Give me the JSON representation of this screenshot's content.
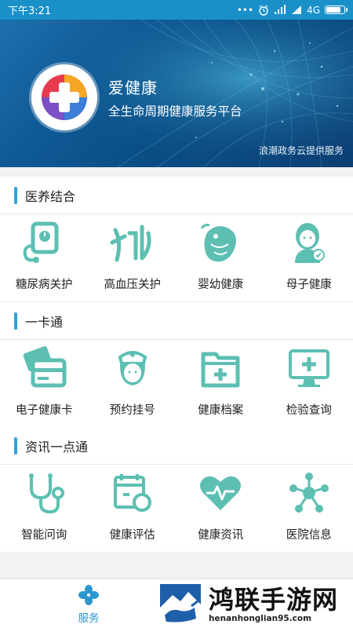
{
  "status_bar": {
    "time": "下午3:21",
    "network": "4G",
    "battery_level": 0.85
  },
  "banner": {
    "app_name": "爱健康",
    "subtitle": "全生命周期健康服务平台",
    "provider": "浪潮政务云提供服务"
  },
  "sections": [
    {
      "title": "医养结合",
      "items": [
        {
          "label": "糖尿病关护",
          "icon": "glucose-meter-icon"
        },
        {
          "label": "高血压关护",
          "icon": "blood-pressure-icon"
        },
        {
          "label": "婴幼健康",
          "icon": "baby-fish-icon"
        },
        {
          "label": "母子健康",
          "icon": "mother-child-icon"
        }
      ]
    },
    {
      "title": "一卡通",
      "items": [
        {
          "label": "电子健康卡",
          "icon": "health-card-icon"
        },
        {
          "label": "预约挂号",
          "icon": "nurse-icon"
        },
        {
          "label": "健康档案",
          "icon": "medical-folder-icon"
        },
        {
          "label": "检验查询",
          "icon": "monitor-cross-icon"
        }
      ]
    },
    {
      "title": "资讯一点通",
      "items": [
        {
          "label": "智能问询",
          "icon": "stethoscope-icon"
        },
        {
          "label": "健康评估",
          "icon": "calendar-check-icon"
        },
        {
          "label": "健康资讯",
          "icon": "heart-pulse-icon"
        },
        {
          "label": "医院信息",
          "icon": "network-nodes-icon"
        }
      ]
    }
  ],
  "tabbar": {
    "tabs": [
      {
        "label": "服务",
        "icon": "clover-icon",
        "active": true
      }
    ]
  },
  "watermark": {
    "name": "鸿联手游网",
    "url": "henanhonglian95.com"
  },
  "colors": {
    "status_bar": "#1a90c9",
    "accent": "#2ba3d9",
    "icon": "#5dbfb2",
    "tab_active": "#2b97d1"
  }
}
